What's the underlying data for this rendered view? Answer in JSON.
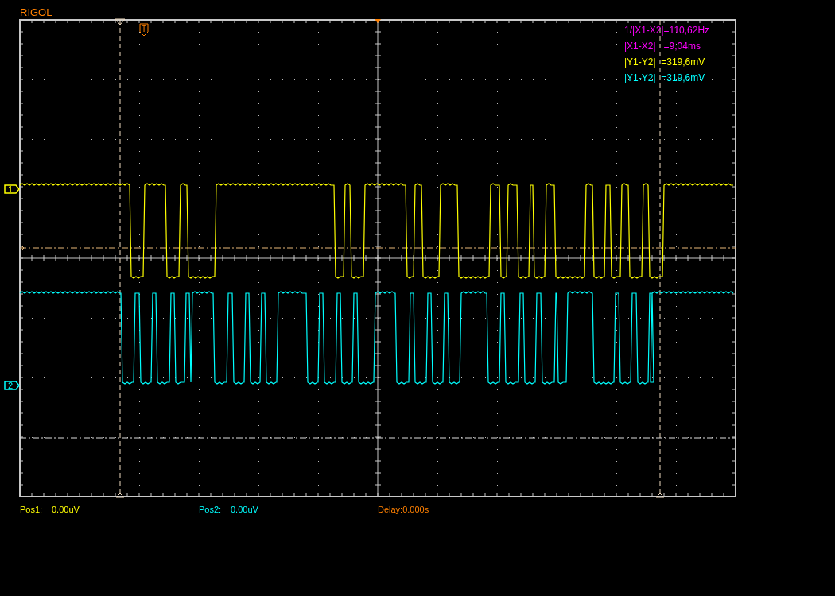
{
  "brand": "RIGOL",
  "trigger_marker": "T",
  "channels": [
    {
      "marker": "1",
      "color": "#ffff00"
    },
    {
      "marker": "2",
      "color": "#00ffff"
    }
  ],
  "measurements": [
    {
      "text": "1/|X1-X2|=110,62Hz",
      "color": "#ff00ff"
    },
    {
      "text": "|X1-X2|   =9,04ms",
      "color": "#ff00ff"
    },
    {
      "text": "|Y1-Y2|  =319,6mV",
      "color": "#ffff00"
    },
    {
      "text": "|Y1-Y2|  =319,6mV",
      "color": "#00ffff"
    }
  ],
  "footer": {
    "pos1_label": "Pos1:",
    "pos1_value": "0.00uV",
    "pos2_label": "Pos2:",
    "pos2_value": "0.00uV",
    "delay": "Delay:0.000s"
  }
}
